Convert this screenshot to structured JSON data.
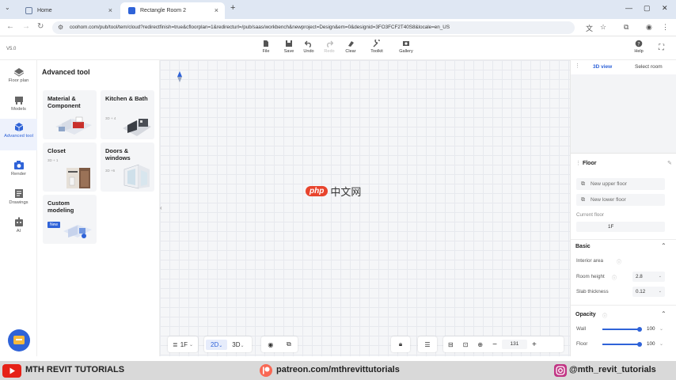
{
  "browser": {
    "tabs": [
      {
        "label": "Home",
        "icon": "home-icon"
      },
      {
        "label": "Rectangle Room 2",
        "icon": "app-icon"
      }
    ],
    "url": "coohom.com/pub/tool/tem/cloud?redirectfinish=true&cfloorplan=1&redirecturl=/pub/saas/workbench&newproject=Design&em=0&designid=3FO3FCF2T40S8&locale=en_US"
  },
  "app": {
    "version": "V5.0",
    "toolbar": [
      {
        "label": "File",
        "icon": "file-icon"
      },
      {
        "label": "Save",
        "icon": "save-icon"
      },
      {
        "label": "Undo",
        "icon": "undo-icon"
      },
      {
        "label": "Redo",
        "icon": "redo-icon"
      },
      {
        "label": "Clear",
        "icon": "clear-icon"
      },
      {
        "label": "Toolkit",
        "icon": "toolkit-icon"
      },
      {
        "label": "Gallery",
        "icon": "gallery-icon"
      }
    ],
    "help_label": "Help"
  },
  "rail": [
    {
      "label": "Floor plan",
      "icon": "floor-plan-icon"
    },
    {
      "label": "Models",
      "icon": "models-icon"
    },
    {
      "label": "Advanced tool",
      "icon": "advanced-tool-icon"
    },
    {
      "label": "Render",
      "icon": "render-icon"
    },
    {
      "label": "Drawings",
      "icon": "drawings-icon"
    },
    {
      "label": "AI",
      "icon": "ai-icon"
    }
  ],
  "panel": {
    "title": "Advanced tool",
    "cards": [
      {
        "title": "Material & Component",
        "sub": ""
      },
      {
        "title": "Kitchen & Bath",
        "sub": "3D + 4"
      },
      {
        "title": "Closet",
        "sub": "3D + 1"
      },
      {
        "title": "Doors & windows",
        "sub": "3D +6"
      },
      {
        "title": "Custom modeling",
        "badge": "New"
      }
    ]
  },
  "watermark": {
    "badge": "php",
    "text": "中文网"
  },
  "bottom": {
    "floor": "1F",
    "view2d": "2D",
    "view3d": "3D",
    "zoom": "131"
  },
  "right": {
    "tab_3d": "3D view",
    "tab_select": "Select room",
    "floor_title": "Floor",
    "new_upper": "New upper floor",
    "new_lower": "New lower floor",
    "current_floor_label": "Current floor",
    "current_floor_value": "1F",
    "basic_title": "Basic",
    "interior_area_label": "Interior area",
    "room_height_label": "Room height",
    "room_height_value": "2.8",
    "slab_label": "Slab thickness",
    "slab_value": "0.12",
    "opacity_title": "Opacity",
    "wall_label": "Wall",
    "wall_value": "100",
    "floor_label": "Floor",
    "floor_value": "100"
  },
  "footer": {
    "left": "MTH REVIT TUTORIALS",
    "center": "patreon.com/mthrevittutorials",
    "right": "@mth_revit_tutorials"
  },
  "colors": {
    "accent": "#2f63d8",
    "youtube": "#e62117",
    "patreon": "#f96854",
    "instagram": "#c13584"
  }
}
